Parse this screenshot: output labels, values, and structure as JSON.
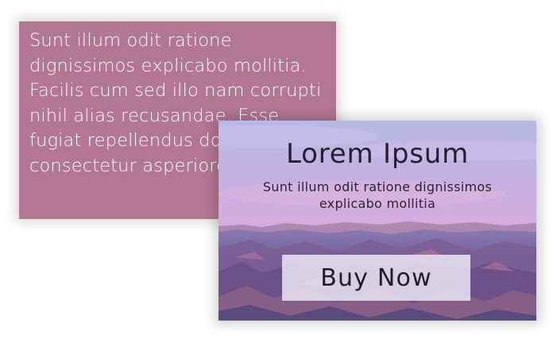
{
  "text_card": {
    "text": "Sunt illum odit ratione dignissimos explicabo mollitia. Facilis cum sed illo nam corrupti nihil alias recusandae. Esse fugiat repellendus dolorem consectetur asperiores et"
  },
  "promo_card": {
    "title": "Lorem Ipsum",
    "subtitle": "Sunt illum odit ratione dignissimos explicabo mollitia",
    "button_label": "Buy Now",
    "background_image": "canyon-landscape-at-dusk"
  },
  "colors": {
    "text_card_background": "#b37693",
    "text_card_text": "#ffffff",
    "sky_top": "#b8b9e3",
    "sky_pink": "#e6a6d4",
    "canyon": "#6d5f98",
    "button_background": "#ece8f5",
    "title_text": "#222031"
  }
}
